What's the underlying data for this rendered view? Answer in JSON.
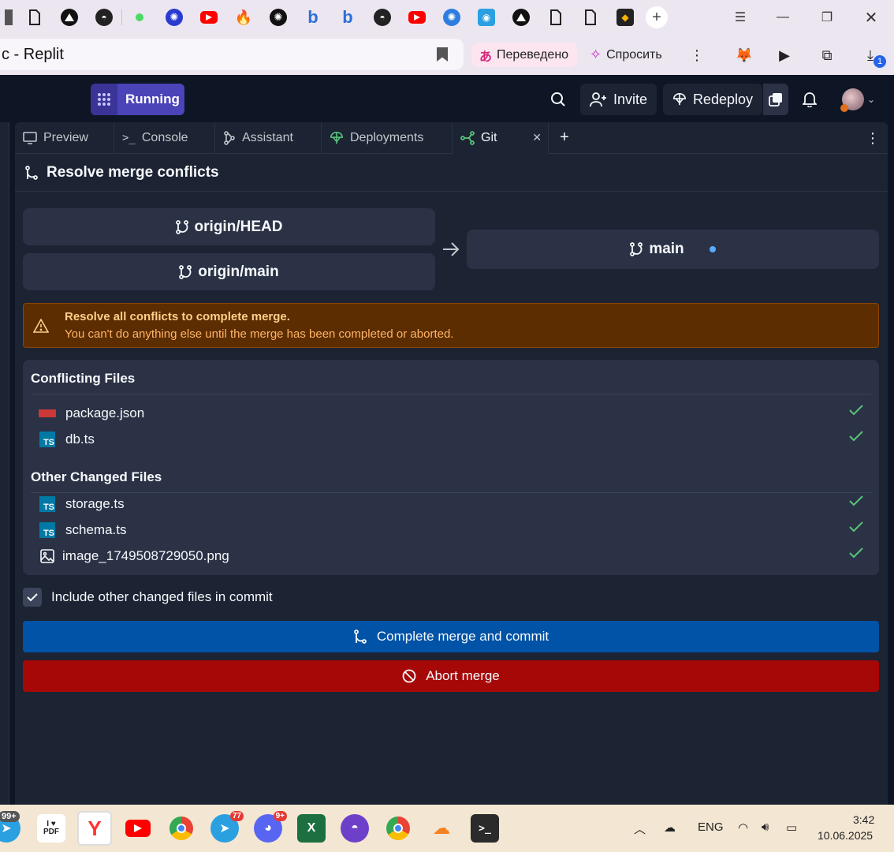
{
  "browser": {
    "tab_title_fragment": "c - Replit",
    "translate_label": "Переведено",
    "ask_label": "Спросить",
    "download_badge": "1"
  },
  "header": {
    "run_status": "Running",
    "invite_label": "Invite",
    "redeploy_label": "Redeploy"
  },
  "panel_tabs": [
    {
      "label": "Preview"
    },
    {
      "label": "Console"
    },
    {
      "label": "Assistant"
    },
    {
      "label": "Deployments"
    },
    {
      "label": "Git"
    }
  ],
  "merge": {
    "title": "Resolve merge conflicts",
    "source_branches": [
      "origin/HEAD",
      "origin/main"
    ],
    "target_branch": "main",
    "warning_title": "Resolve all conflicts to complete merge.",
    "warning_text": "You can't do anything else until the merge has been completed or aborted.",
    "conflicting_heading": "Conflicting Files",
    "conflicting_files": [
      {
        "name": "package.json",
        "icon": "npm-icon"
      },
      {
        "name": "db.ts",
        "icon": "typescript-icon"
      }
    ],
    "other_heading": "Other Changed Files",
    "other_files": [
      {
        "name": "storage.ts",
        "icon": "typescript-icon"
      },
      {
        "name": "schema.ts",
        "icon": "typescript-icon"
      },
      {
        "name": "image_1749508729050.png",
        "icon": "image-icon"
      }
    ],
    "include_label": "Include other changed files in commit",
    "complete_label": "Complete merge and commit",
    "abort_label": "Abort merge",
    "colors": {
      "warning_bg": "#5c2d00",
      "complete_bg": "#0053a6",
      "abort_bg": "#a60808",
      "check": "#58c47a"
    }
  },
  "taskbar": {
    "badge_left": "99+",
    "telegram_badge": "77",
    "discord_badge": "9+",
    "language": "ENG",
    "time": "3:42",
    "date": "10.06.2025"
  }
}
